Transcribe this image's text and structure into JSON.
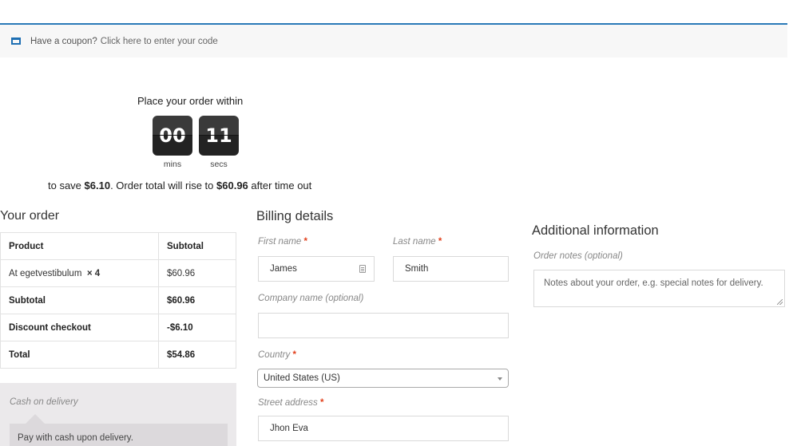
{
  "coupon": {
    "prompt": "Have a coupon?",
    "link": "Click here to enter your code"
  },
  "timer": {
    "heading": "Place your order within",
    "minutes": "00",
    "seconds": "11",
    "minutes_label": "mins",
    "seconds_label": "secs",
    "save_prefix": "to save ",
    "save_amount": "$6.10",
    "save_middle": ". Order total will rise to ",
    "future_total": "$60.96",
    "save_suffix": " after time out"
  },
  "order": {
    "title": "Your order",
    "headers": [
      "Product",
      "Subtotal"
    ],
    "item": {
      "name": "At egetvestibulum",
      "qty": "× 4",
      "price": "$60.96"
    },
    "subtotal": {
      "label": "Subtotal",
      "value": "$60.96"
    },
    "discount": {
      "label": "Discount checkout",
      "value": "-$6.10"
    },
    "total": {
      "label": "Total",
      "value": "$54.86"
    }
  },
  "payment": {
    "method": "Cash on delivery",
    "description": "Pay with cash upon delivery."
  },
  "billing": {
    "title": "Billing details",
    "first_name_label": "First name",
    "first_name": "James",
    "last_name_label": "Last name",
    "last_name": "Smith",
    "company_label": "Company name (optional)",
    "company": "",
    "country_label": "Country",
    "country": "United States (US)",
    "street_label": "Street address",
    "street": "Jhon Eva",
    "required_mark": "*"
  },
  "additional": {
    "title": "Additional information",
    "notes_label": "Order notes (optional)",
    "notes_placeholder": "Notes about your order, e.g. special notes for delivery."
  },
  "colors": {
    "accent": "#2a7ab8",
    "required": "#e2401c",
    "timer_bg": "#2e2e2e"
  }
}
